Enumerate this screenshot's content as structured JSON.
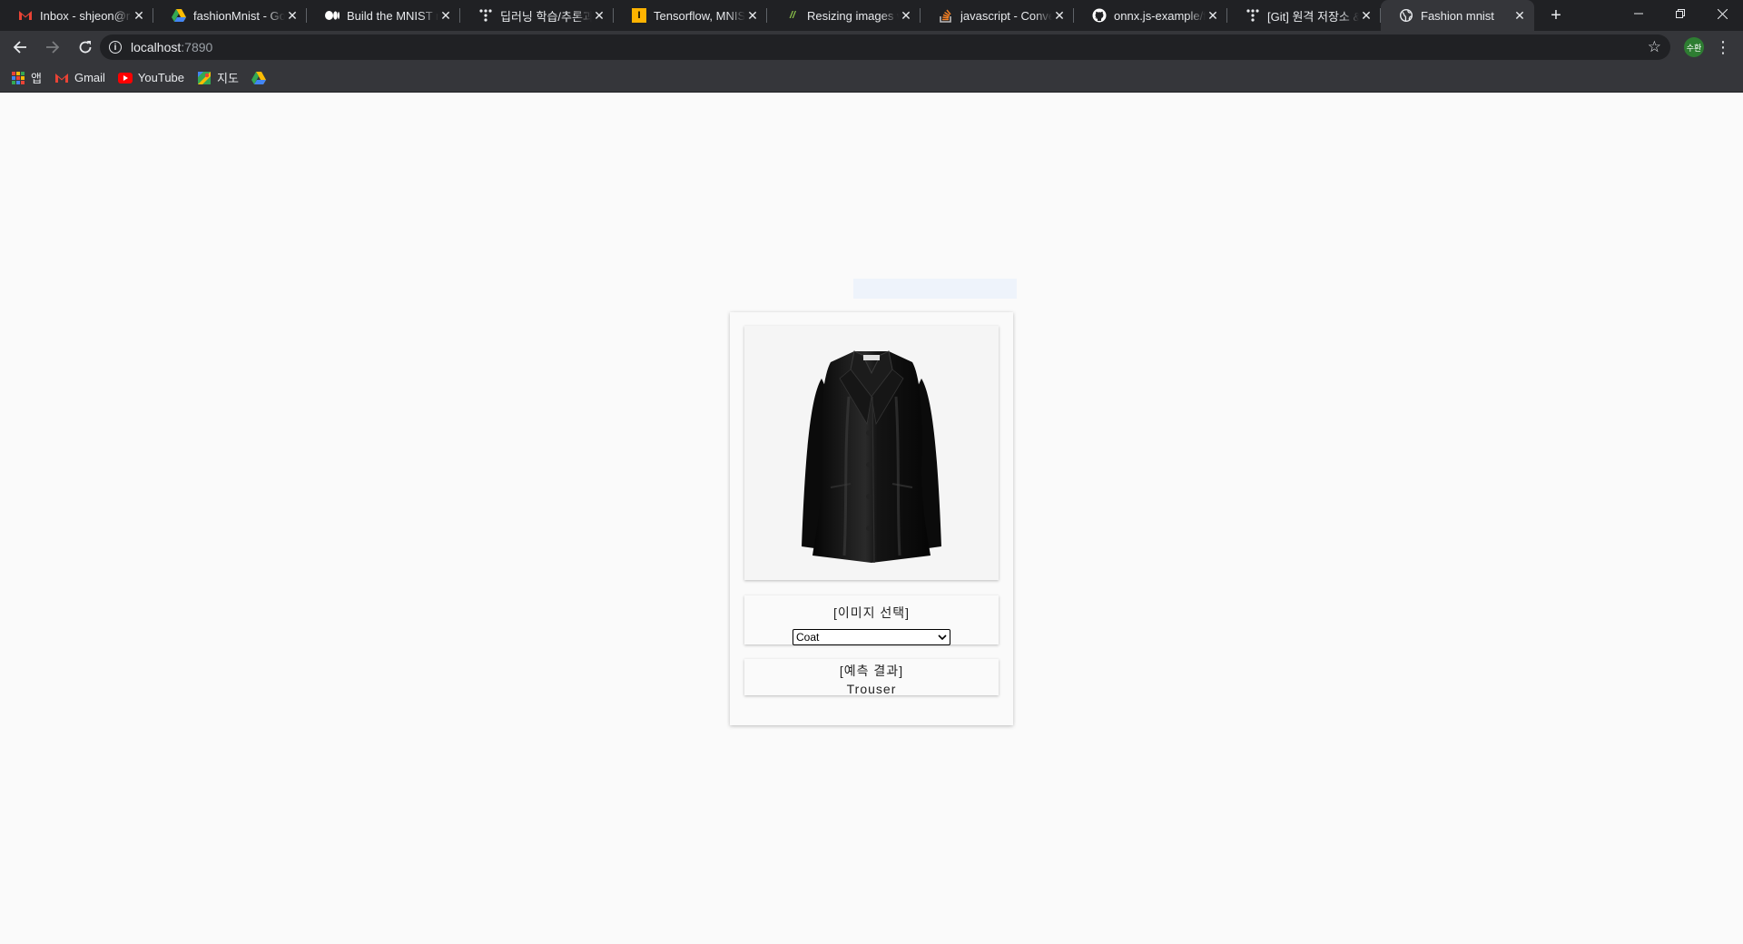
{
  "browser": {
    "tabs": [
      {
        "title": "Inbox - shjeon@rsu",
        "favicon": "gmail-icon",
        "color": "#ea4335"
      },
      {
        "title": "fashionMnist - Goo",
        "favicon": "google-drive-icon",
        "color": "#fbbc04"
      },
      {
        "title": "Build the MNIST m",
        "favicon": "medium-icon",
        "color": "#ffffff"
      },
      {
        "title": "딥러닝 학습/추론과",
        "favicon": "tistory-icon",
        "color": "#e8eaed"
      },
      {
        "title": "Tensorflow, MNIST",
        "favicon": "tensorflow-icon",
        "color": "#ffb300"
      },
      {
        "title": "Resizing images wi",
        "favicon": "slash-icon",
        "color": "#8bc34a"
      },
      {
        "title": "javascript - Conver",
        "favicon": "stackoverflow-icon",
        "color": "#f48024"
      },
      {
        "title": "onnx.js-example/fa",
        "favicon": "github-icon",
        "color": "#ffffff"
      },
      {
        "title": "[Git] 원격 저장소 &",
        "favicon": "tistory-icon",
        "color": "#e8eaed"
      },
      {
        "title": "Fashion mnist",
        "favicon": "globe-icon",
        "color": "#e8eaed",
        "active": true
      }
    ],
    "new_tab": "+",
    "url_host": "localhost",
    "url_port": ":7890",
    "profile": "수환",
    "bookmarks": [
      {
        "label": "앱",
        "icon": "apps-icon"
      },
      {
        "label": "Gmail",
        "icon": "gmail-icon"
      },
      {
        "label": "YouTube",
        "icon": "youtube-icon"
      },
      {
        "label": "지도",
        "icon": "maps-icon"
      },
      {
        "label": "",
        "icon": "google-drive-icon"
      }
    ]
  },
  "page": {
    "select_heading": "[이미지 선택]",
    "selected_option": "Coat",
    "result_heading": "[예측 결과]",
    "result_value": "Trouser"
  }
}
